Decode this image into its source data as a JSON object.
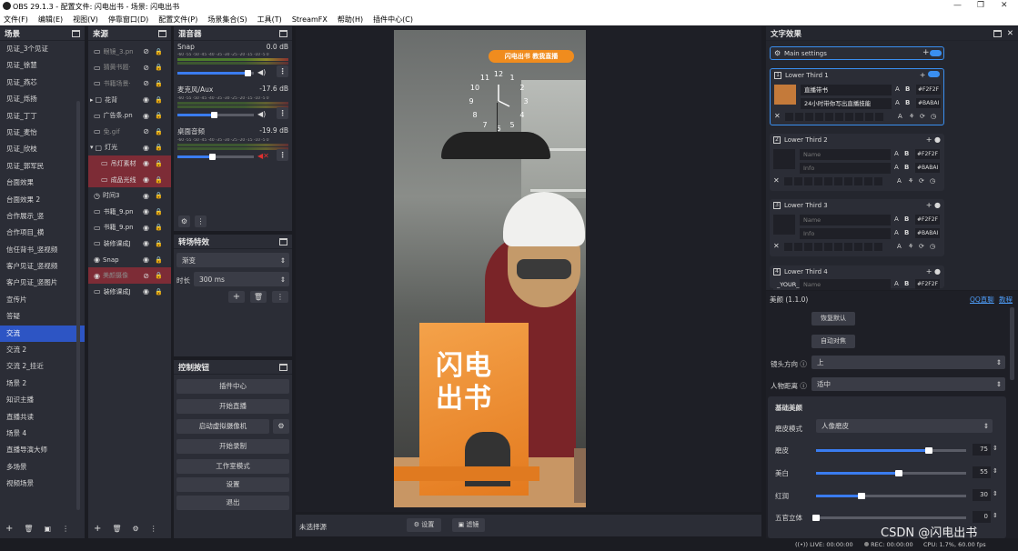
{
  "window": {
    "title": "OBS 29.1.3 - 配置文件: 闪电出书 - 场景: 闪电出书"
  },
  "menu": [
    "文件(F)",
    "编辑(E)",
    "视图(V)",
    "停靠窗口(D)",
    "配置文件(P)",
    "场景集合(S)",
    "工具(T)",
    "StreamFX",
    "帮助(H)",
    "插件中心(C)"
  ],
  "scenes": {
    "title": "场景",
    "items": [
      "见证_3个见证",
      "见证_徐慧",
      "见证_燕芯",
      "见证_烁扬",
      "见证_丁丁",
      "见证_麦怡",
      "见证_欣枝",
      "见证_郭军民",
      "台面效果",
      "台面效果 2",
      "合作展示_竖",
      "合作项目_横",
      "信任背书_竖视频",
      "客户见证_竖视频",
      "客户见证_竖图片",
      "宣传片",
      "答疑",
      "交流",
      "交流 2",
      "交流 2_挂近",
      "场景 2",
      "知识主播",
      "直播共读",
      "场景 4",
      "直播导演大师",
      "多场景",
      "视频场景"
    ],
    "active": "交流"
  },
  "sources": {
    "title": "来源",
    "items": [
      {
        "name": "眼镜_3.pn",
        "icon": "image",
        "vis": "hidden"
      },
      {
        "name": "猜黄书题·",
        "icon": "image",
        "vis": "hidden"
      },
      {
        "name": "书籍场景·",
        "icon": "image",
        "vis": "hidden"
      },
      {
        "name": "花背",
        "icon": "folder",
        "vis": "shown"
      },
      {
        "name": "广告条.pn",
        "icon": "image",
        "vis": "shown"
      },
      {
        "name": "免.gif",
        "icon": "image",
        "vis": "hidden"
      },
      {
        "name": "灯光",
        "icon": "folder",
        "vis": "shown"
      },
      {
        "name": "吊灯素材",
        "icon": "image",
        "vis": "shown",
        "red": true
      },
      {
        "name": "成品光线",
        "icon": "image",
        "vis": "shown",
        "red": true
      },
      {
        "name": "时间3",
        "icon": "clock",
        "vis": "shown"
      },
      {
        "name": "书籍_9.pn",
        "icon": "image",
        "vis": "shown"
      },
      {
        "name": "书籍_9.pn",
        "icon": "image",
        "vis": "shown"
      },
      {
        "name": "装修课成J",
        "icon": "image",
        "vis": "shown"
      },
      {
        "name": "Snap",
        "icon": "camera",
        "vis": "shown"
      },
      {
        "name": "美颜摄像",
        "icon": "camera",
        "vis": "hidden",
        "red": true
      },
      {
        "name": "装修课成J",
        "icon": "image",
        "vis": "shown"
      }
    ]
  },
  "mixer": {
    "title": "混音器",
    "ticks": "-60 -55 -50 -45 -40 -35 -30 -25 -20 -15 -10 -5 0",
    "channels": [
      {
        "name": "Snap",
        "db": "0.0 dB",
        "level": 0.92,
        "muted": false
      },
      {
        "name": "麦克风/Aux",
        "db": "-17.6 dB",
        "level": 0.48,
        "muted": false
      },
      {
        "name": "桌面音频",
        "db": "-19.9 dB",
        "level": 0.45,
        "muted": true
      }
    ]
  },
  "transitions": {
    "title": "转场特效",
    "type": "渐变",
    "duration_label": "时长",
    "duration": "300 ms"
  },
  "controls": {
    "title": "控制按钮",
    "buttons": [
      "插件中心",
      "开始直播",
      "启动虚拟摄像机",
      "开始录制",
      "工作室模式",
      "设置",
      "退出"
    ]
  },
  "preview": {
    "banner": "闪电出书  教我直播",
    "book_title": "闪电出书",
    "clock": [
      "12",
      "1",
      "2",
      "3",
      "4",
      "5",
      "6",
      "7",
      "8",
      "9",
      "10",
      "11"
    ]
  },
  "text_effects": {
    "title": "文字效果",
    "main": "Main settings",
    "items": [
      {
        "num": "1",
        "name": "Lower Third 1",
        "line1": "直播带书",
        "line2": "24小时带你写出直播技能",
        "color1": "#F2F2F",
        "color2": "#BABAI",
        "selected": true
      },
      {
        "num": "2",
        "name": "Lower Third 2",
        "line1": "Name",
        "line2": "Info",
        "color1": "#F2F2F",
        "color2": "#BABAI",
        "selected": false
      },
      {
        "num": "3",
        "name": "Lower Third 3",
        "line1": "Name",
        "line2": "Info",
        "color1": "#F2F2F",
        "color2": "#BABAI",
        "selected": false
      },
      {
        "num": "4",
        "name": "Lower Third 4",
        "line1": "_YOUR_",
        "line2": "Name",
        "color1": "#F2F2F",
        "color2": "",
        "selected": false
      }
    ]
  },
  "beauty": {
    "title": "美颜 (1.1.0)",
    "link1": "QQ直聊",
    "link2": "教程",
    "reset": "恢复默认",
    "auto": "自动对焦",
    "direction_label": "镜头方向",
    "direction": "上",
    "distance_label": "人物距离",
    "distance": "适中",
    "section": "基础美颜",
    "mode_label": "磨皮模式",
    "mode": "人像磨皮",
    "sliders": [
      {
        "label": "磨皮",
        "value": 75
      },
      {
        "label": "美白",
        "value": 55
      },
      {
        "label": "红润",
        "value": 30
      },
      {
        "label": "五官立体",
        "value": 0
      }
    ]
  },
  "bottom": {
    "no_source": "未选择源",
    "settings": "设置",
    "filters": "滤镜"
  },
  "status": {
    "live": "LIVE: 00:00:00",
    "rec": "REC: 00:00:00",
    "cpu": "CPU: 1.7%, 60.00 fps"
  },
  "watermark": "CSDN @闪电出书"
}
